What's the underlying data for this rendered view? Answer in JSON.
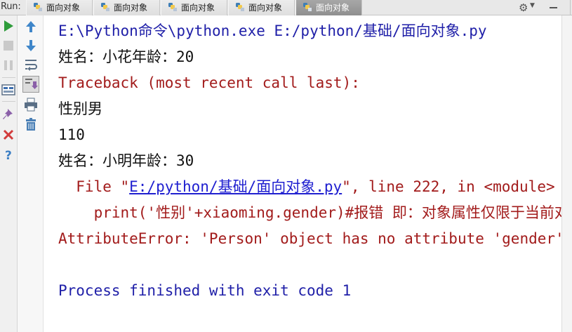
{
  "run_panel": {
    "run_label": "Run:",
    "tabs": [
      {
        "label": "面向对象",
        "active": false
      },
      {
        "label": "面向对象",
        "active": false
      },
      {
        "label": "面向对象",
        "active": false
      },
      {
        "label": "面向对象",
        "active": false
      },
      {
        "label": "面向对象",
        "active": true
      }
    ]
  },
  "console": {
    "lines": [
      {
        "text": "E:\\Python命令\\python.exe E:/python/基础/面向对象.py",
        "style": "blue"
      },
      {
        "text": "姓名：小花年龄：20",
        "style": "black"
      },
      {
        "text": "Traceback (most recent call last):",
        "style": "red"
      },
      {
        "text": "性别男",
        "style": "black"
      },
      {
        "text": "110",
        "style": "black"
      },
      {
        "text": "姓名：小明年龄：30",
        "style": "black"
      },
      {
        "prefix": "  File \"",
        "link": "E:/python/基础/面向对象.py",
        "suffix": "\", line 222, in <module>",
        "style": "red"
      },
      {
        "text": "    print('性别'+xiaoming.gender)#报错 即：对象属性仅限于当前对象",
        "style": "red"
      },
      {
        "text": "AttributeError: 'Person' object has no attribute 'gender'",
        "style": "red"
      },
      {
        "text": "",
        "style": "black"
      },
      {
        "text": "Process finished with exit code 1",
        "style": "blue"
      }
    ]
  },
  "icons": {
    "tab_icon": "python-file-icon",
    "toolbar_left": [
      "run-icon",
      "stop-icon",
      "pause-icon",
      "layout-icon",
      "pin-icon",
      "close-icon",
      "help-icon"
    ],
    "toolbar_left2": [
      "up-arrow-icon",
      "down-arrow-icon",
      "soft-wrap-icon",
      "scroll-to-end-icon",
      "print-icon",
      "trash-icon"
    ],
    "tab_actions": [
      "gear-icon",
      "hide-icon"
    ]
  },
  "colors": {
    "command": "#1f1fa8",
    "stdout": "#111111",
    "stderr": "#a21b1b",
    "link": "#2020d0",
    "run_green": "#2e9c3a"
  }
}
